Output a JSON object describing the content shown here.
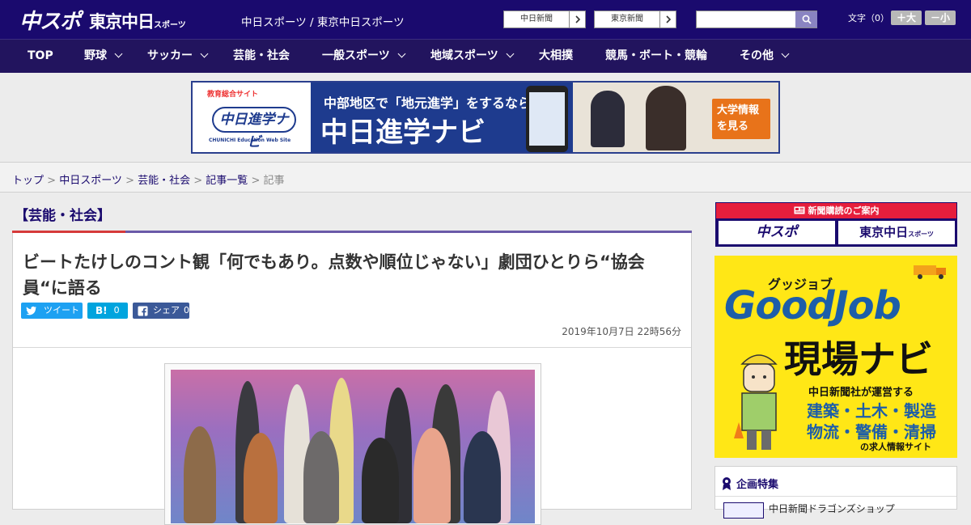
{
  "header": {
    "logo_chuspo": "中スポ",
    "logo_tokyo": "東京中日",
    "logo_tokyo_small": "スポーツ",
    "site_title": "中日スポーツ / 東京中日スポーツ",
    "np_button_1": "中日新聞",
    "np_button_2": "東京新聞",
    "search": {
      "value": "",
      "placeholder": ""
    },
    "font_label": "文字（0）",
    "font_bigger": "＋大",
    "font_smaller": "－小"
  },
  "nav": {
    "items": [
      {
        "label": "TOP",
        "has_dropdown": false
      },
      {
        "label": "野球",
        "has_dropdown": true
      },
      {
        "label": "サッカー",
        "has_dropdown": true
      },
      {
        "label": "芸能・社会",
        "has_dropdown": false
      },
      {
        "label": "一般スポーツ",
        "has_dropdown": true
      },
      {
        "label": "地域スポーツ",
        "has_dropdown": true
      },
      {
        "label": "大相撲",
        "has_dropdown": false
      },
      {
        "label": "競馬・ボート・競輪",
        "has_dropdown": false
      },
      {
        "label": "その他",
        "has_dropdown": true
      }
    ]
  },
  "banner": {
    "small_label": "教育総合サイト",
    "logo_text": "中日進学ナビ",
    "logo_english": "CHUNICHI Education Web Site",
    "headline_1": "中部地区で「地元進学」をするなら",
    "headline_2": "中日進学ナビ",
    "cta": "大学情報を見る"
  },
  "breadcrumb": {
    "items": [
      "トップ",
      "中日スポーツ",
      "芸能・社会",
      "記事一覧"
    ],
    "current": "記事",
    "separator": " > "
  },
  "article": {
    "category": "【芸能・社会】",
    "title": "ビートたけしのコント観「何でもあり。点数や順位じゃない」劇団ひとりら“協会員“に語る",
    "share": {
      "tweet_label": "ツイート",
      "hatena_label": "B!",
      "hatena_count": "0",
      "facebook_label": "シェア",
      "facebook_count": "0"
    },
    "date": "2019年10月7日 22時56分"
  },
  "sidebar": {
    "subscribe_head": "新聞購読のご案内",
    "subscribe_logo_1": "中スポ",
    "subscribe_logo_2": "東京中日",
    "subscribe_logo_2_small": "スポーツ",
    "goodjob": {
      "ruby": "グッジョブ",
      "title": "GoodJob",
      "subtitle": "現場ナビ",
      "operator": "中日新聞社が運営する",
      "line1": "建築・土木・製造",
      "line2": "物流・警備・清掃",
      "line3": "の求人情報サイト"
    },
    "feature_head": "企画特集",
    "feature_item": "中日新聞ドラゴンズショップ"
  },
  "colors": {
    "header_bg": "#1a0a6e",
    "nav_bg": "#22145e",
    "accent_red": "#e61e3c",
    "twitter": "#1da1f2",
    "hatena": "#00a4de",
    "facebook": "#3b5998",
    "goodjob_yellow": "#ffe716"
  },
  "icons": [
    "search-icon",
    "chevron-right-icon",
    "chevron-down-icon",
    "twitter-icon",
    "hatena-icon",
    "facebook-icon",
    "newspaper-icon",
    "ribbon-icon"
  ]
}
